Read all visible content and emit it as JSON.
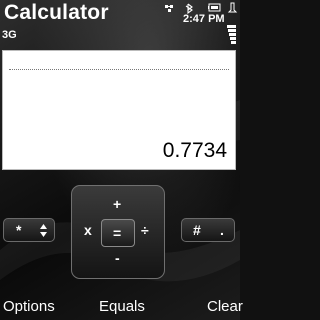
{
  "app": {
    "title": "Calculator"
  },
  "status_bar": {
    "network": "3G",
    "time": "2:47 PM"
  },
  "display": {
    "result": "0.7734"
  },
  "keypad": {
    "left_key": {
      "symbol": "*",
      "arrows": "▲▼"
    },
    "right_key": {
      "symbol": "#",
      "dot": "."
    },
    "center": {
      "up": "+",
      "left": "x",
      "select": "=",
      "right": "÷",
      "down": "-"
    }
  },
  "softkeys": {
    "left": "Options",
    "middle": "Equals",
    "right": "Clear"
  }
}
